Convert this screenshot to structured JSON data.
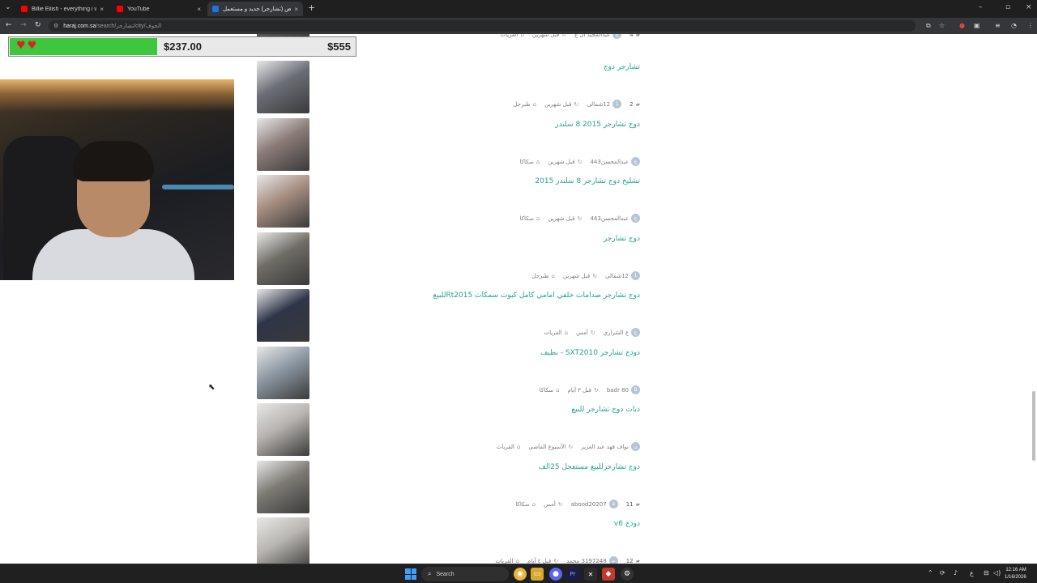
{
  "browser": {
    "tabs": [
      {
        "title": "Billie Eilish - everything i wanted",
        "icon": "youtube-icon",
        "color": "#ff0000"
      },
      {
        "title": "YouTube",
        "icon": "youtube-icon",
        "color": "#ff0000"
      },
      {
        "title": "افضل عروض (تشارجر) جديد و مستعمل",
        "icon": "haraj-icon",
        "color": "#1a73e8"
      }
    ],
    "new_tab": "+",
    "address": {
      "host": "haraj.com.sa",
      "path": "/search/تشارجر/city/الجوف"
    }
  },
  "overlay": {
    "hearts": "♥♥",
    "current_amount": "$237.00",
    "goal_amount": "$555",
    "progress": 0.427
  },
  "listings": [
    {
      "title": "",
      "city": "القريات",
      "time": "قبل شهرين",
      "user": "عبدالمجيد ال ع",
      "avatar": "ع",
      "comments": "4",
      "thumb_color": "#5a5a5a"
    },
    {
      "title": "تشارجر دوج",
      "city": "طبرجل",
      "time": "قبل شهرين",
      "user": "12شمالي",
      "avatar": "1",
      "comments": "2",
      "thumb_color": "#6b6d75"
    },
    {
      "title": "دوج تشارجر 2015 8 سلندر",
      "city": "سكاكا",
      "time": "قبل شهرين",
      "user": "عبدالمحسن443",
      "avatar": "ع",
      "comments": "",
      "thumb_color": "#8a7b78"
    },
    {
      "title": "تشليح دوج تشارجر 8 سلندر 2015",
      "city": "سكاكا",
      "time": "قبل شهرين",
      "user": "عبدالمحسن443",
      "avatar": "ع",
      "comments": "",
      "thumb_color": "#a58c7f"
    },
    {
      "title": "دوج تشارجر",
      "city": "طبرجل",
      "time": "قبل شهرين",
      "user": "12شمالي",
      "avatar": "1",
      "comments": "",
      "thumb_color": "#6f6c66"
    },
    {
      "title": "دوج تشارجر صدامات خلفي امامي كامل كبوت سمكات Rt2015للبيع",
      "city": "القريات",
      "time": "أمس",
      "user": "ع الشراري",
      "avatar": "ع",
      "comments": "",
      "thumb_color": "#2f3548"
    },
    {
      "title": "دودج تشارجر SXT2010 - نظيف",
      "city": "سكاكا",
      "time": "قبل ٣ أيام",
      "user": "badr 80",
      "avatar": "B",
      "comments": "",
      "thumb_color": "#8c97a3"
    },
    {
      "title": "دبات دوج تشارجر للبيع",
      "city": "القريات",
      "time": "الأسبوع الماضي",
      "user": "نواف فهد عبد العزيز",
      "avatar": "ن",
      "comments": "",
      "thumb_color": "#b7b3b0"
    },
    {
      "title": "دوج تشارجرللبيع مستعجل 25الف",
      "city": "سكاكا",
      "time": "أمس",
      "user": "abood20207",
      "avatar": "a",
      "comments": "11",
      "thumb_color": "#7d7a74"
    },
    {
      "title": "دودج v6",
      "city": "القريات",
      "time": "قبل ٤ أيام",
      "user": "3197248 محمد",
      "avatar": "م",
      "comments": "12",
      "thumb_color": "#b9b6b1"
    }
  ],
  "taskbar": {
    "search_placeholder": "Search",
    "time": "12:16 AM",
    "date": "1/16/2026",
    "lang": "ع"
  }
}
